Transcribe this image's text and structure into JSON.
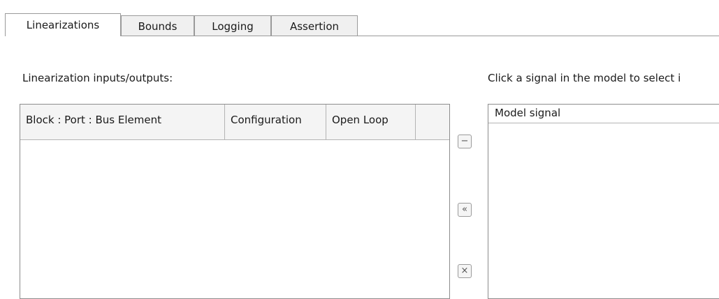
{
  "tabs": [
    {
      "label": "Linearizations",
      "active": true
    },
    {
      "label": "Bounds",
      "active": false
    },
    {
      "label": "Logging",
      "active": false
    },
    {
      "label": "Assertion",
      "active": false
    }
  ],
  "io_section": {
    "label": "Linearization inputs/outputs:",
    "columns": [
      "Block : Port : Bus Element",
      "Configuration",
      "Open Loop"
    ],
    "rows": []
  },
  "side_buttons": [
    {
      "name": "remove",
      "icon": "minus-icon",
      "glyph": "−"
    },
    {
      "name": "add",
      "icon": "double-left-arrow-icon",
      "glyph": "«"
    },
    {
      "name": "clear",
      "icon": "close-icon",
      "glyph": "×"
    }
  ],
  "signal_section": {
    "label": "Click a signal in the model to select i",
    "column": "Model signal",
    "rows": []
  }
}
